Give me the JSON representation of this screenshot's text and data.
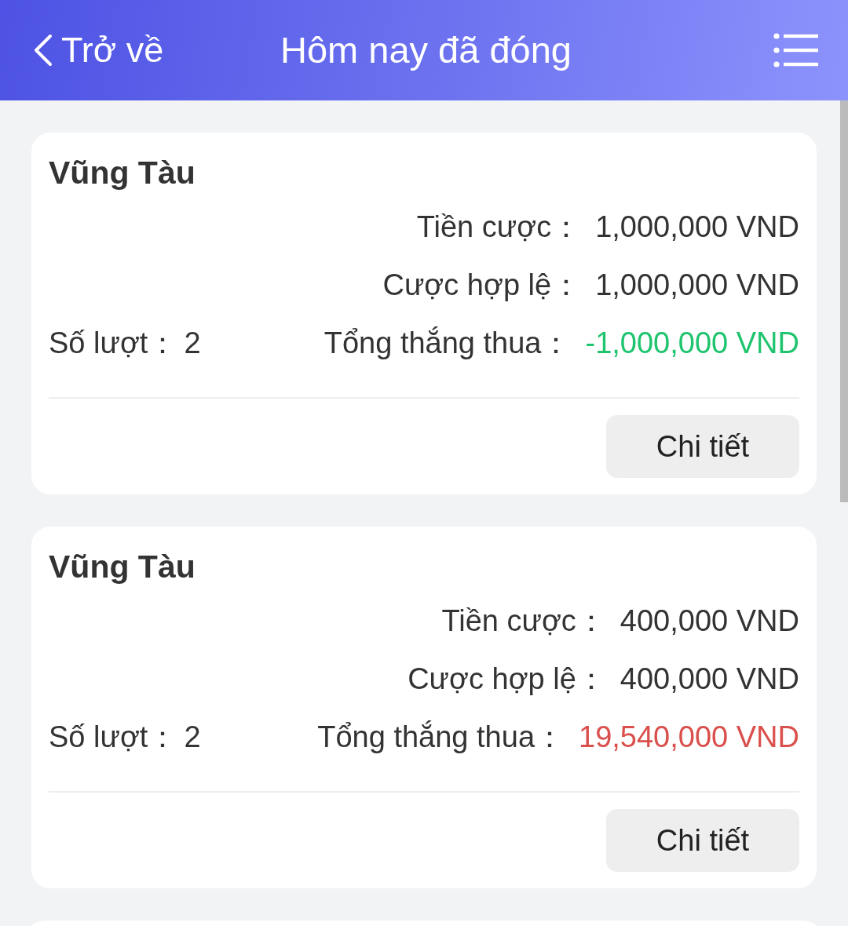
{
  "header": {
    "back_label": "Trở về",
    "title": "Hôm nay đã đóng"
  },
  "cards": [
    {
      "title": "Vũng Tàu",
      "bet": {
        "label": "Tiền cược：",
        "value": "1,000,000 VND"
      },
      "valid_bet": {
        "label": "Cược hợp lệ：",
        "value": "1,000,000 VND"
      },
      "rounds": {
        "label": "Số lượt：",
        "value": "2"
      },
      "total": {
        "label": "Tổng thắng thua：",
        "value": "-1,000,000 VND",
        "color": "#1fc46e"
      },
      "button": "Chi tiết"
    },
    {
      "title": "Vũng Tàu",
      "bet": {
        "label": "Tiền cược：",
        "value": "400,000 VND"
      },
      "valid_bet": {
        "label": "Cược hợp lệ：",
        "value": "400,000 VND"
      },
      "rounds": {
        "label": "Số lượt：",
        "value": "2"
      },
      "total": {
        "label": "Tổng thắng thua：",
        "value": "19,540,000 VND",
        "color": "#d9504c"
      },
      "button": "Chi tiết"
    }
  ]
}
